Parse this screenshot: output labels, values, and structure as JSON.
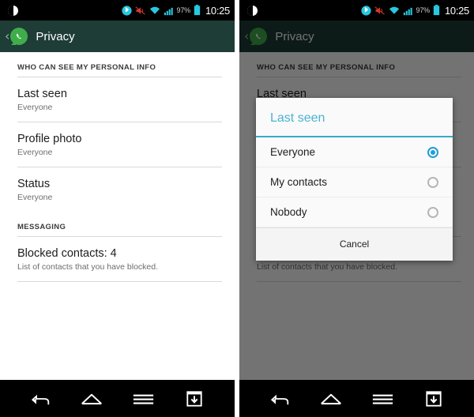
{
  "statusbar": {
    "brightness_icon": "brightness-icon",
    "bluetooth_icon": "bluetooth-icon",
    "mute_icon": "volume-mute-icon",
    "wifi_icon": "wifi-icon",
    "signal_icon": "cellular-signal-icon",
    "battery_percent": "97%",
    "battery_icon": "battery-icon",
    "time": "10:25"
  },
  "appbar": {
    "back_label": "‹",
    "logo": "whatsapp-logo",
    "title": "Privacy"
  },
  "sections": [
    {
      "header": "WHO CAN SEE MY PERSONAL INFO",
      "items": [
        {
          "title": "Last seen",
          "subtitle": "Everyone"
        },
        {
          "title": "Profile photo",
          "subtitle": "Everyone"
        },
        {
          "title": "Status",
          "subtitle": "Everyone"
        }
      ]
    },
    {
      "header": "MESSAGING",
      "items": [
        {
          "title": "Blocked contacts: 4",
          "subtitle": "List of contacts that you have blocked."
        }
      ]
    }
  ],
  "dialog": {
    "title": "Last seen",
    "options": [
      {
        "label": "Everyone",
        "selected": true
      },
      {
        "label": "My contacts",
        "selected": false
      },
      {
        "label": "Nobody",
        "selected": false
      }
    ],
    "cancel_label": "Cancel"
  },
  "navbar": {
    "back_icon": "back-arrow-icon",
    "home_icon": "home-icon",
    "menu_icon": "menu-icon",
    "save_icon": "save-download-icon"
  },
  "colors": {
    "appbar_bg": "#1e3d36",
    "accent_teal": "#4ab3d1",
    "radio_selected": "#1e9fd4",
    "whatsapp_green": "#3fae4a",
    "status_cyan": "#29c7e0"
  }
}
